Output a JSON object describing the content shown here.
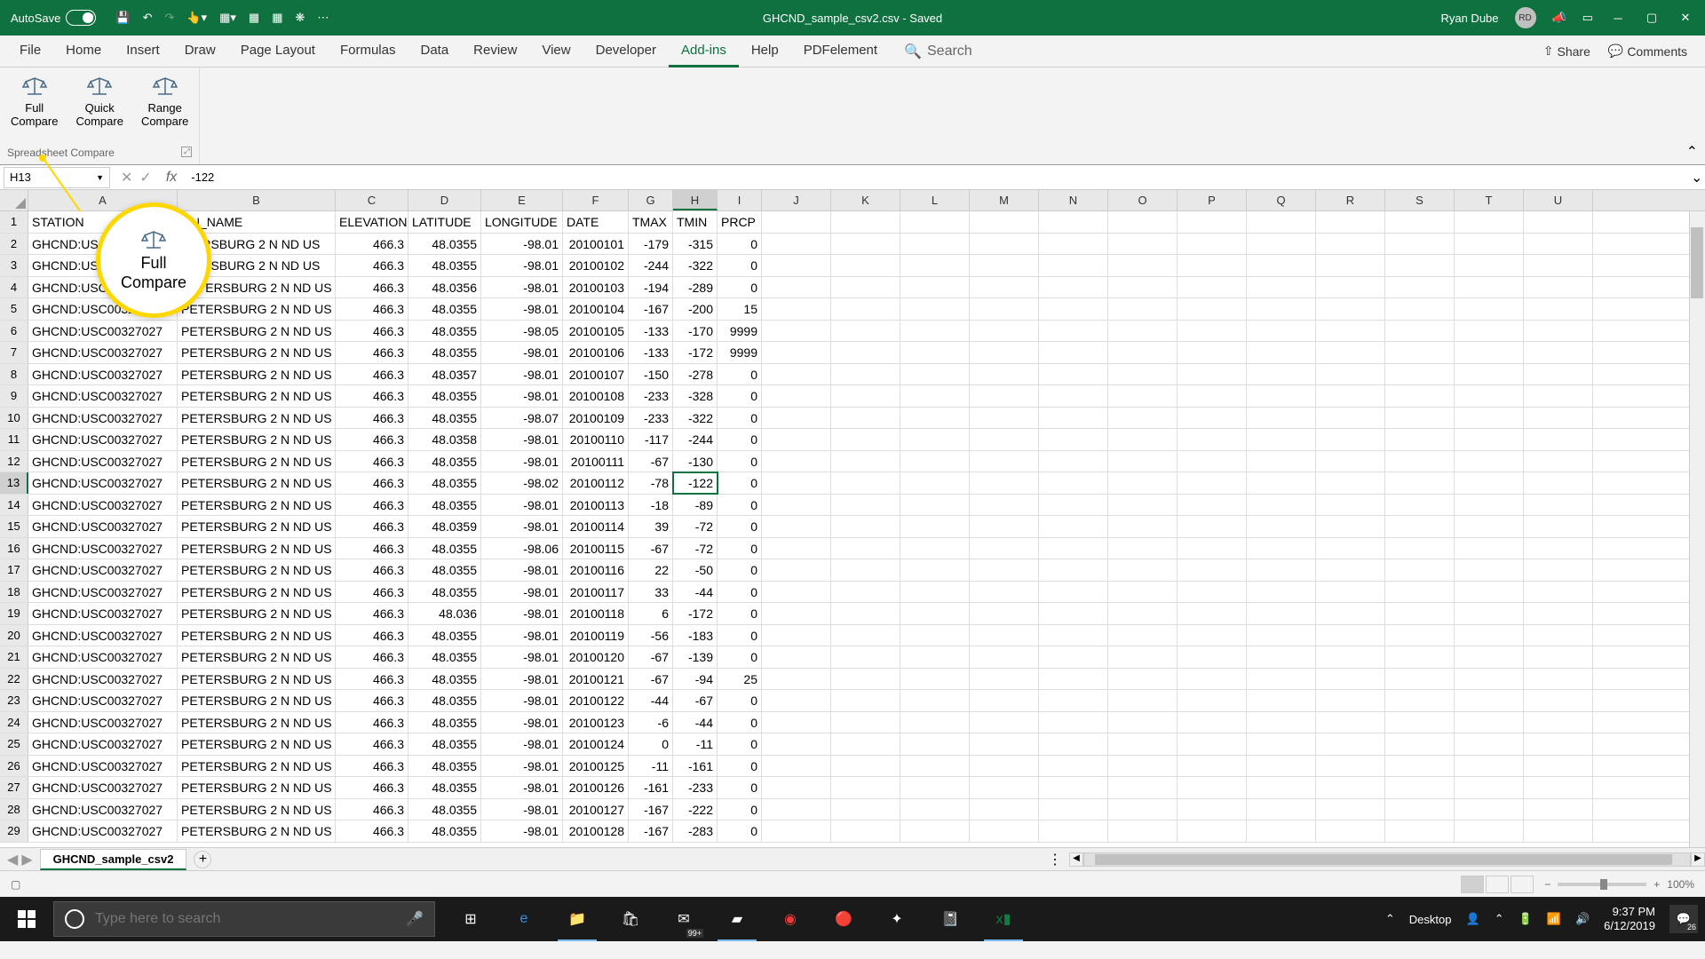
{
  "titlebar": {
    "autosave": "AutoSave",
    "autosave_state": "Off",
    "title": "GHCND_sample_csv2.csv - Saved",
    "user": "Ryan Dube",
    "initials": "RD"
  },
  "tabs": [
    "File",
    "Home",
    "Insert",
    "Draw",
    "Page Layout",
    "Formulas",
    "Data",
    "Review",
    "View",
    "Developer",
    "Add-ins",
    "Help",
    "PDFelement"
  ],
  "active_tab": "Add-ins",
  "search_placeholder": "Search",
  "share": "Share",
  "comments": "Comments",
  "ribbon": {
    "buttons": [
      {
        "line1": "Full",
        "line2": "Compare"
      },
      {
        "line1": "Quick",
        "line2": "Compare"
      },
      {
        "line1": "Range",
        "line2": "Compare"
      }
    ],
    "group_label": "Spreadsheet Compare"
  },
  "callout": {
    "line1": "Full",
    "line2": "Compare"
  },
  "formula_bar": {
    "name_box": "H13",
    "value": "-122"
  },
  "columns": [
    "A",
    "B",
    "C",
    "D",
    "E",
    "F",
    "G",
    "H",
    "I",
    "J",
    "K",
    "L",
    "M",
    "N",
    "O",
    "P",
    "Q",
    "R",
    "S",
    "T",
    "U"
  ],
  "selected_column": "H",
  "selected_row": 13,
  "headers": [
    "STATION",
    "ON_NAME",
    "ELEVATION",
    "LATITUDE",
    "LONGITUDE",
    "DATE",
    "TMAX",
    "TMIN",
    "PRCP"
  ],
  "headers_display": {
    "1": "STATION",
    "2": "ON_NAME"
  },
  "chart_data": {
    "type": "table",
    "title": "GHCND_sample_csv2",
    "columns": [
      "STATION",
      "STATION_NAME",
      "ELEVATION",
      "LATITUDE",
      "LONGITUDE",
      "DATE",
      "TMAX",
      "TMIN",
      "PRCP"
    ],
    "rows": [
      [
        "GHCND:US…",
        "…ERSBURG 2 N ND US",
        466.3,
        48.0355,
        -98.01,
        20100101,
        -179,
        -315,
        0
      ],
      [
        "GHCND:USC…",
        "…ERSBURG 2 N ND US",
        466.3,
        48.0355,
        -98.01,
        20100102,
        -244,
        -322,
        0
      ],
      [
        "GHCND:USC00327…",
        "PETERSBURG 2 N ND US",
        466.3,
        48.0356,
        -98.01,
        20100103,
        -194,
        -289,
        0
      ],
      [
        "GHCND:USC00327027",
        "PETERSBURG 2 N ND US",
        466.3,
        48.0355,
        -98.01,
        20100104,
        -167,
        -200,
        15
      ],
      [
        "GHCND:USC00327027",
        "PETERSBURG 2 N ND US",
        466.3,
        48.0355,
        -98.05,
        20100105,
        -133,
        -170,
        9999
      ],
      [
        "GHCND:USC00327027",
        "PETERSBURG 2 N ND US",
        466.3,
        48.0355,
        -98.01,
        20100106,
        -133,
        -172,
        9999
      ],
      [
        "GHCND:USC00327027",
        "PETERSBURG 2 N ND US",
        466.3,
        48.0357,
        -98.01,
        20100107,
        -150,
        -278,
        0
      ],
      [
        "GHCND:USC00327027",
        "PETERSBURG 2 N ND US",
        466.3,
        48.0355,
        -98.01,
        20100108,
        -233,
        -328,
        0
      ],
      [
        "GHCND:USC00327027",
        "PETERSBURG 2 N ND US",
        466.3,
        48.0355,
        -98.07,
        20100109,
        -233,
        -322,
        0
      ],
      [
        "GHCND:USC00327027",
        "PETERSBURG 2 N ND US",
        466.3,
        48.0358,
        -98.01,
        20100110,
        -117,
        -244,
        0
      ],
      [
        "GHCND:USC00327027",
        "PETERSBURG 2 N ND US",
        466.3,
        48.0355,
        -98.01,
        20100111,
        -67,
        -130,
        0
      ],
      [
        "GHCND:USC00327027",
        "PETERSBURG 2 N ND US",
        466.3,
        48.0355,
        -98.02,
        20100112,
        -78,
        -122,
        0
      ],
      [
        "GHCND:USC00327027",
        "PETERSBURG 2 N ND US",
        466.3,
        48.0355,
        -98.01,
        20100113,
        -18,
        -89,
        0
      ],
      [
        "GHCND:USC00327027",
        "PETERSBURG 2 N ND US",
        466.3,
        48.0359,
        -98.01,
        20100114,
        39,
        -72,
        0
      ],
      [
        "GHCND:USC00327027",
        "PETERSBURG 2 N ND US",
        466.3,
        48.0355,
        -98.06,
        20100115,
        -67,
        -72,
        0
      ],
      [
        "GHCND:USC00327027",
        "PETERSBURG 2 N ND US",
        466.3,
        48.0355,
        -98.01,
        20100116,
        22,
        -50,
        0
      ],
      [
        "GHCND:USC00327027",
        "PETERSBURG 2 N ND US",
        466.3,
        48.0355,
        -98.01,
        20100117,
        33,
        -44,
        0
      ],
      [
        "GHCND:USC00327027",
        "PETERSBURG 2 N ND US",
        466.3,
        48.036,
        -98.01,
        20100118,
        6,
        -172,
        0
      ],
      [
        "GHCND:USC00327027",
        "PETERSBURG 2 N ND US",
        466.3,
        48.0355,
        -98.01,
        20100119,
        -56,
        -183,
        0
      ],
      [
        "GHCND:USC00327027",
        "PETERSBURG 2 N ND US",
        466.3,
        48.0355,
        -98.01,
        20100120,
        -67,
        -139,
        0
      ],
      [
        "GHCND:USC00327027",
        "PETERSBURG 2 N ND US",
        466.3,
        48.0355,
        -98.01,
        20100121,
        -67,
        -94,
        25
      ],
      [
        "GHCND:USC00327027",
        "PETERSBURG 2 N ND US",
        466.3,
        48.0355,
        -98.01,
        20100122,
        -44,
        -67,
        0
      ],
      [
        "GHCND:USC00327027",
        "PETERSBURG 2 N ND US",
        466.3,
        48.0355,
        -98.01,
        20100123,
        -6,
        -44,
        0
      ],
      [
        "GHCND:USC00327027",
        "PETERSBURG 2 N ND US",
        466.3,
        48.0355,
        -98.01,
        20100124,
        0,
        -11,
        0
      ],
      [
        "GHCND:USC00327027",
        "PETERSBURG 2 N ND US",
        466.3,
        48.0355,
        -98.01,
        20100125,
        -11,
        -161,
        0
      ],
      [
        "GHCND:USC00327027",
        "PETERSBURG 2 N ND US",
        466.3,
        48.0355,
        -98.01,
        20100126,
        -161,
        -233,
        0
      ],
      [
        "GHCND:USC00327027",
        "PETERSBURG 2 N ND US",
        466.3,
        48.0355,
        -98.01,
        20100127,
        -167,
        -222,
        0
      ],
      [
        "GHCND:USC00327027",
        "PETERSBURG 2 N ND US",
        466.3,
        48.0355,
        -98.01,
        20100128,
        -167,
        -283,
        0
      ]
    ]
  },
  "sheet_tab": "GHCND_sample_csv2",
  "zoom": "100%",
  "taskbar": {
    "search_placeholder": "Type here to search",
    "desktop": "Desktop",
    "mail_badge": "99+",
    "time": "9:37 PM",
    "date": "6/12/2019",
    "notif_count": "26"
  }
}
